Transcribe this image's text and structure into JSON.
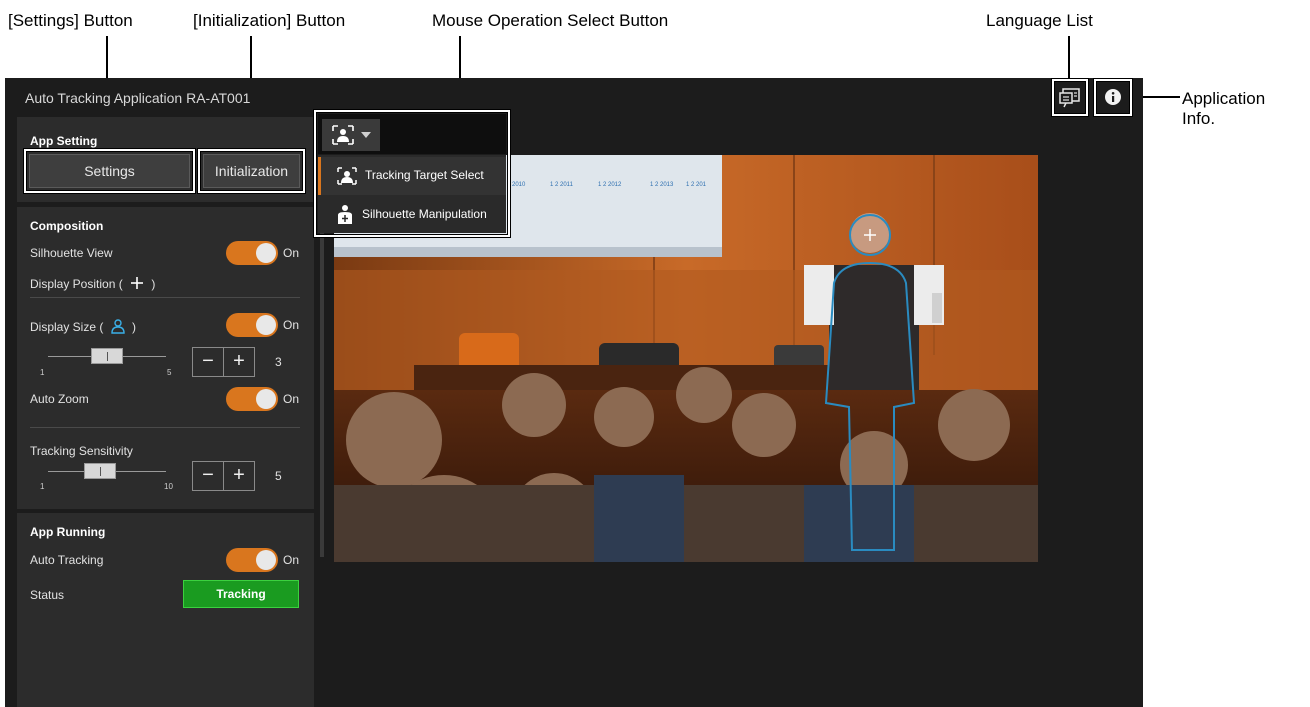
{
  "callouts": {
    "settings_button": "[Settings] Button",
    "initialization_button": "[Initialization] Button",
    "mouse_operation": "Mouse Operation Select Button",
    "language_list": "Language List",
    "application_info_line1": "Application",
    "application_info_line2": "Info."
  },
  "app": {
    "title": "Auto Tracking Application RA-AT001"
  },
  "app_setting": {
    "title": "App Setting",
    "settings_label": "Settings",
    "initialization_label": "Initialization"
  },
  "composition": {
    "title": "Composition",
    "silhouette_view": {
      "label": "Silhouette View",
      "state": "On"
    },
    "display_position": {
      "label": "Display Position (",
      "close": ")"
    },
    "display_size": {
      "label": "Display Size (",
      "close": ")",
      "state": "On",
      "min": "1",
      "max": "5",
      "value": "3",
      "level": 3
    },
    "auto_zoom": {
      "label": "Auto Zoom",
      "state": "On"
    },
    "tracking_sensitivity": {
      "label": "Tracking Sensitivity",
      "min": "1",
      "max": "10",
      "value": "5",
      "level": 5
    }
  },
  "app_running": {
    "title": "App Running",
    "auto_tracking": {
      "label": "Auto Tracking",
      "state": "On"
    },
    "status": {
      "label": "Status",
      "value": "Tracking"
    }
  },
  "mouse_menu": {
    "items": [
      {
        "label": "Tracking Target Select",
        "icon": "tracking-target-icon",
        "selected": true
      },
      {
        "label": "Silhouette Manipulation",
        "icon": "silhouette-manipulation-icon",
        "selected": false
      }
    ]
  },
  "stepper": {
    "minus": "−",
    "plus": "+"
  },
  "video_slide_text": [
    "2010",
    "1 2 2011",
    "1 2 2012",
    "1 2 2013",
    "1 2 201"
  ],
  "colors": {
    "accent_orange": "#d9761e",
    "status_green": "#1a9b20",
    "panel": "#2c2c2c",
    "background": "#1c1c1c",
    "silhouette_outline": "#2a8bc0"
  }
}
